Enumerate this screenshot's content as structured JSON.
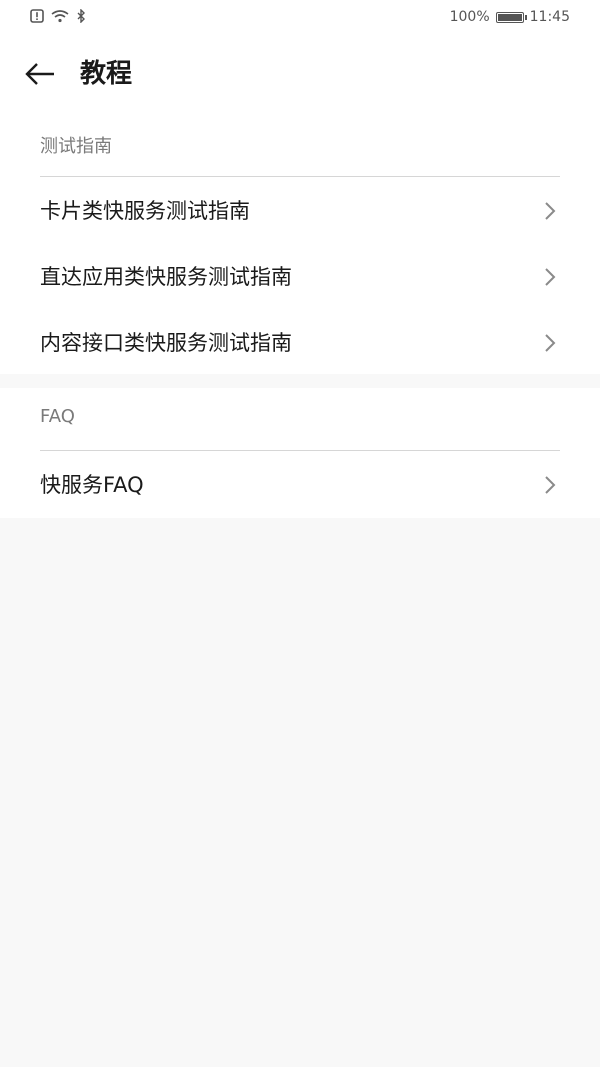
{
  "status_bar": {
    "battery_text": "100%",
    "time": "11:45",
    "battery_level": 1.0,
    "icons": [
      "alert-icon",
      "wifi-icon",
      "bluetooth-icon",
      "battery-icon"
    ]
  },
  "header": {
    "title": "教程",
    "back_icon": "back-arrow-icon"
  },
  "sections": {
    "test_guide": {
      "heading": "测试指南",
      "items": [
        {
          "label": "卡片类快服务测试指南"
        },
        {
          "label": "直达应用类快服务测试指南"
        },
        {
          "label": "内容接口类快服务测试指南"
        }
      ]
    },
    "faq": {
      "heading": "FAQ",
      "items": [
        {
          "label": "快服务FAQ"
        }
      ]
    }
  },
  "colors": {
    "background": "#f8f8f8",
    "card": "#ffffff",
    "text_primary": "#1a1a1a",
    "text_secondary": "#7a7a7a",
    "chevron": "#8a8a8a"
  }
}
